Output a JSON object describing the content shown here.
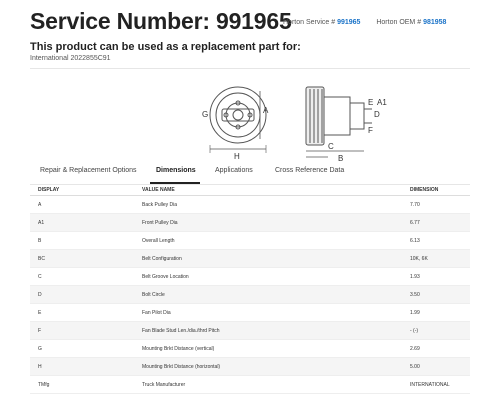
{
  "header": {
    "title": "Service Number: 991965",
    "horton_service_label": "Horton Service #",
    "horton_service_number": "991965",
    "horton_oem_label": "Horton OEM #",
    "horton_oem_number": "981958",
    "subtitle": "This product can be used as a replacement part for:",
    "replacement_part": "International 2022855C91"
  },
  "diagram": {
    "labels": [
      "G",
      "A",
      "H",
      "E",
      "A1",
      "D",
      "F",
      "C",
      "B"
    ]
  },
  "tabs": [
    {
      "label": "Repair & Replacement Options",
      "active": false
    },
    {
      "label": "Dimensions",
      "active": true
    },
    {
      "label": "Applications",
      "active": false
    },
    {
      "label": "Cross Reference Data",
      "active": false
    }
  ],
  "table": {
    "headers": [
      "DISPLAY",
      "VALUE NAME",
      "DIMENSION"
    ],
    "rows": [
      {
        "display": "A",
        "name": "Back Pulley Dia",
        "value": "7.70"
      },
      {
        "display": "A1",
        "name": "Front Pulley Dia",
        "value": "6.77"
      },
      {
        "display": "B",
        "name": "Overall Length",
        "value": "6.13"
      },
      {
        "display": "BC",
        "name": "Belt Configuration",
        "value": "10K, 6K"
      },
      {
        "display": "C",
        "name": "Belt Groove Location",
        "value": "1.93"
      },
      {
        "display": "D",
        "name": "Bolt Circle",
        "value": "3.50"
      },
      {
        "display": "E",
        "name": "Fan Pilot Dia",
        "value": "1.99"
      },
      {
        "display": "F",
        "name": "Fan Blade Stud Len./dia./thrd Pitch",
        "value": "- (-)"
      },
      {
        "display": "G",
        "name": "Mounting Brkt Distance (vertical)",
        "value": "2.69"
      },
      {
        "display": "H",
        "name": "Mounting Brkt Distance (horizontal)",
        "value": "5.00"
      },
      {
        "display": "TMfg",
        "name": "Truck Manufacturer",
        "value": "INTERNATIONAL"
      }
    ]
  }
}
